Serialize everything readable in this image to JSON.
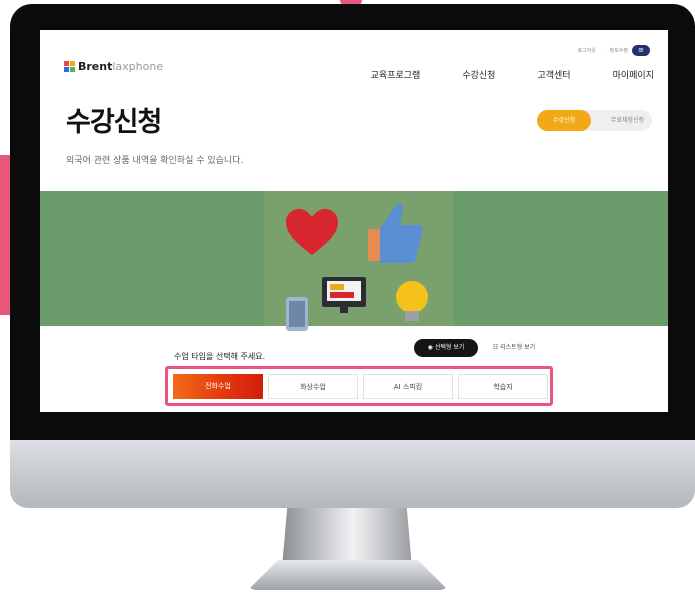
{
  "site": {
    "logo_bold": "Brent",
    "logo_rest": "laxphone"
  },
  "util": {
    "login": "로그아웃",
    "info": "정보수정",
    "menu_icon": "hamburger-icon"
  },
  "gnb": [
    "교육프로그램",
    "수강신청",
    "고객센터",
    "마이페이지"
  ],
  "page": {
    "title": "수강신청",
    "subtitle": "외국어 관련 상품 내역을 확인하실 수 있습니다."
  },
  "tabs": {
    "active": "수강신청",
    "inactive": "무료체험신청"
  },
  "section": {
    "label": "수업 타입을 선택해 주세요.",
    "view_card": "선택형 보기",
    "view_list": "리스트형 보기"
  },
  "class_types": [
    "전화수업",
    "화상수업",
    "AI 스피킹",
    "학습지"
  ],
  "colors": {
    "accent_orange": "#f1a917",
    "active_red": "#e3350e",
    "highlight_pink": "#e8567c",
    "banner_green": "#6a9b6b",
    "nav_blue": "#23326f"
  }
}
